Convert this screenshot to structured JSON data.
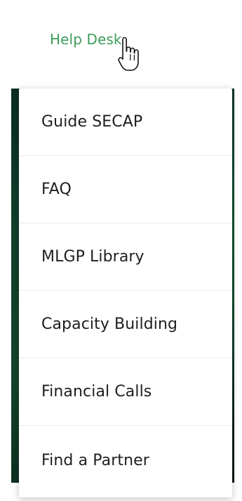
{
  "header": {
    "help_desk_label": "Help Desk",
    "accent_color": "#3f9b5a"
  },
  "cursor": {
    "icon": "hand-pointer-icon"
  },
  "dropdown": {
    "items": [
      {
        "label": "Guide SECAP"
      },
      {
        "label": "FAQ"
      },
      {
        "label": "MLGP Library"
      },
      {
        "label": "Capacity Building"
      },
      {
        "label": "Financial Calls"
      },
      {
        "label": "Find a Partner"
      }
    ]
  }
}
